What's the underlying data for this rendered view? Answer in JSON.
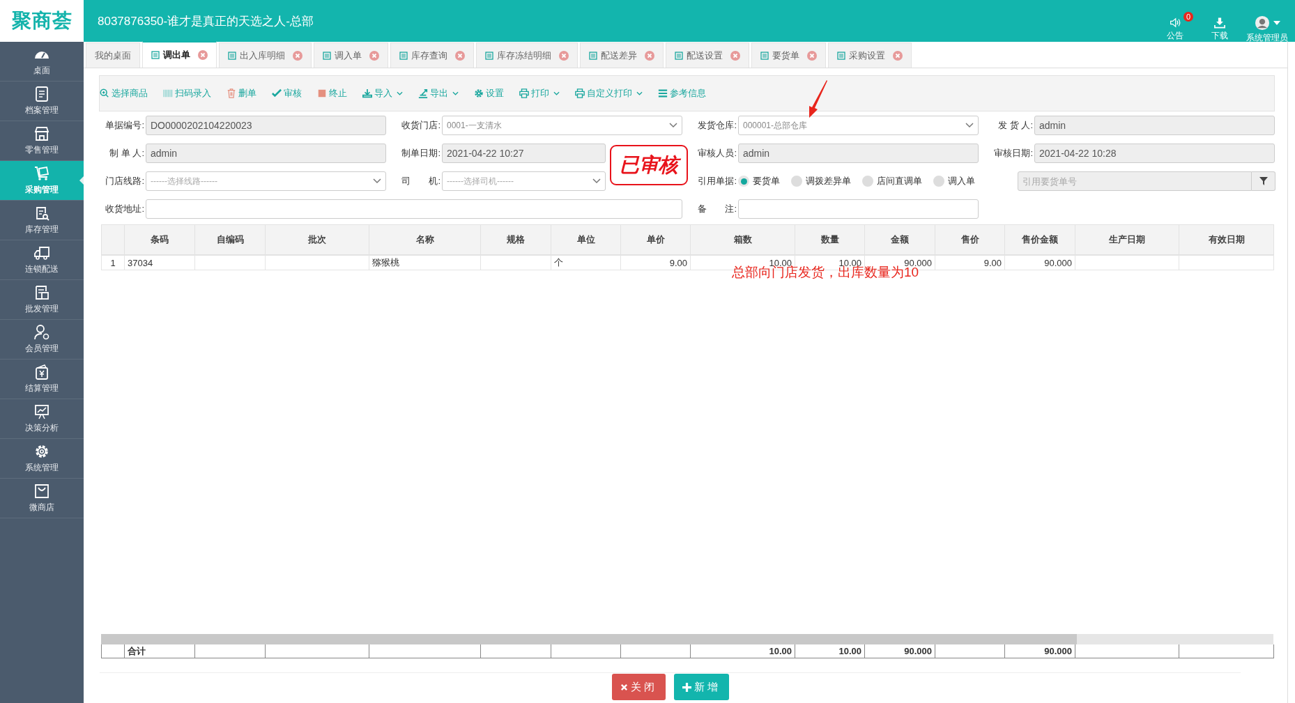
{
  "header": {
    "logo": "聚商荟",
    "title": "8037876350-谁才是真正的天选之人-总部",
    "notice": {
      "label": "公告",
      "badge": "0"
    },
    "download": {
      "label": "下载"
    },
    "user": {
      "name": "系统管理员"
    }
  },
  "sidebar": {
    "items": [
      {
        "label": "桌面",
        "selected": false
      },
      {
        "label": "档案管理",
        "selected": false
      },
      {
        "label": "零售管理",
        "selected": false
      },
      {
        "label": "采购管理",
        "selected": true
      },
      {
        "label": "库存管理",
        "selected": false
      },
      {
        "label": "连锁配送",
        "selected": false
      },
      {
        "label": "批发管理",
        "selected": false
      },
      {
        "label": "会员管理",
        "selected": false
      },
      {
        "label": "结算管理",
        "selected": false
      },
      {
        "label": "决策分析",
        "selected": false
      },
      {
        "label": "系统管理",
        "selected": false
      },
      {
        "label": "微商店",
        "selected": false
      }
    ]
  },
  "tabs": [
    {
      "label": "我的桌面",
      "selected": false,
      "closable": false
    },
    {
      "label": "调出单",
      "selected": true,
      "closable": true
    },
    {
      "label": "出入库明细",
      "selected": false,
      "closable": true
    },
    {
      "label": "调入单",
      "selected": false,
      "closable": true
    },
    {
      "label": "库存查询",
      "selected": false,
      "closable": true
    },
    {
      "label": "库存冻结明细",
      "selected": false,
      "closable": true
    },
    {
      "label": "配送差异",
      "selected": false,
      "closable": true
    },
    {
      "label": "配送设置",
      "selected": false,
      "closable": true
    },
    {
      "label": "要货单",
      "selected": false,
      "closable": true
    },
    {
      "label": "采购设置",
      "selected": false,
      "closable": true
    }
  ],
  "toolbar": [
    {
      "label": "选择商品",
      "dropdown": false
    },
    {
      "label": "扫码录入",
      "dropdown": false
    },
    {
      "label": "删单",
      "dropdown": false
    },
    {
      "label": "审核",
      "dropdown": false
    },
    {
      "label": "终止",
      "dropdown": false
    },
    {
      "label": "导入",
      "dropdown": true
    },
    {
      "label": "导出",
      "dropdown": true
    },
    {
      "label": "设置",
      "dropdown": false
    },
    {
      "label": "打印",
      "dropdown": true
    },
    {
      "label": "自定义打印",
      "dropdown": true
    },
    {
      "label": "参考信息",
      "dropdown": false
    }
  ],
  "form": {
    "stamp": "已审核",
    "fields": [
      {
        "kind": "text",
        "label": "单据编号:",
        "value": "DO0000202104220023"
      },
      {
        "kind": "select",
        "label": "收货门店:",
        "value": "0001-一支清水"
      },
      {
        "kind": "select",
        "label": "发货仓库:",
        "value": "000001-总部仓库"
      },
      {
        "kind": "text",
        "label": "发 货 人:",
        "value": "admin"
      },
      {
        "kind": "text",
        "label": "制 单 人:",
        "value": "admin"
      },
      {
        "kind": "short_text",
        "label": "制单日期:",
        "value": "2021-04-22 10:27"
      },
      {
        "kind": "text",
        "label": "审核人员:",
        "value": "admin"
      },
      {
        "kind": "text",
        "label": "审核日期:",
        "value": "2021-04-22 10:28"
      },
      {
        "kind": "select",
        "label": "门店线路:",
        "placeholder": "------选择线路------"
      },
      {
        "kind": "short_select",
        "label": "司　　机:",
        "placeholder": "------选择司机------"
      },
      {
        "kind": "radio_group",
        "label": "引用单据:",
        "options": [
          {
            "label": "要货单",
            "selected": true
          },
          {
            "label": "调拨差异单",
            "selected": false
          },
          {
            "label": "店间直调单",
            "selected": false
          },
          {
            "label": "调入单",
            "selected": false
          }
        ]
      },
      {
        "kind": "lookup",
        "placeholder": "引用要货单号"
      },
      {
        "kind": "long_input",
        "label": "收货地址:"
      },
      {
        "kind": "input",
        "label": "备　　注:"
      }
    ]
  },
  "table": {
    "columns": [
      "条码",
      "自编码",
      "批次",
      "名称",
      "规格",
      "单位",
      "单价",
      "箱数",
      "数量",
      "金额",
      "售价",
      "售价金额",
      "生产日期",
      "有效日期"
    ],
    "rows": [
      {
        "index": "1",
        "barcode": "37034",
        "name": "猕猴桃",
        "unit": "个",
        "price": "9.00",
        "cases": "10.00",
        "qty": "10.00",
        "amount": "90.000",
        "sale_price": "9.00",
        "sale_amount": "90.000"
      }
    ],
    "totals": {
      "label": "合计",
      "cases": "10.00",
      "qty": "10.00",
      "amount": "90.000",
      "sale_amount": "90.000"
    },
    "annotation": "总部向门店发货，出库数量为10"
  },
  "buttons": [
    {
      "label": "关闭",
      "kind": "close"
    },
    {
      "label": "新增",
      "kind": "add"
    }
  ]
}
